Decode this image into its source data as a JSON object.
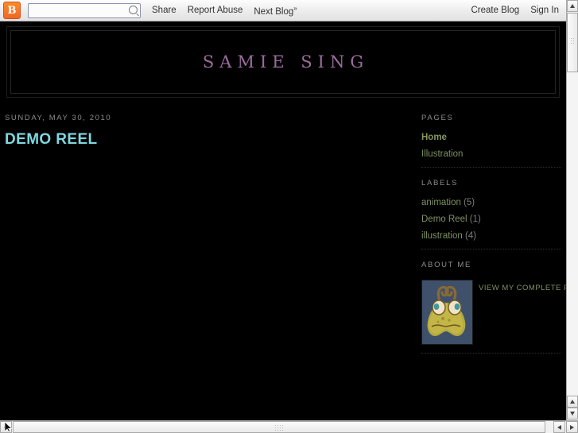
{
  "navbar": {
    "logo_icon": "blogger-b-icon",
    "logo_letter": "B",
    "search_placeholder": "",
    "search_value": "",
    "search_icon": "search-icon",
    "links": [
      {
        "label": "Share"
      },
      {
        "label": "Report Abuse"
      },
      {
        "label": "Next Blog",
        "chevron": "»"
      }
    ],
    "right_links": [
      {
        "label": "Create Blog"
      },
      {
        "label": "Sign In"
      }
    ]
  },
  "header": {
    "blog_title": "SAMIE SING",
    "title_color": "#9d6b9e"
  },
  "post": {
    "date": "SUNDAY, MAY 30, 2010",
    "title": "DEMO REEL",
    "title_color": "#7fd8e0"
  },
  "sidebar": {
    "pages": {
      "title": "PAGES",
      "items": [
        {
          "label": "Home",
          "current": true
        },
        {
          "label": "Illustration",
          "current": false
        }
      ]
    },
    "labels": {
      "title": "LABELS",
      "items": [
        {
          "label": "animation",
          "count": "(5)"
        },
        {
          "label": "Demo Reel",
          "count": "(1)"
        },
        {
          "label": "illustration",
          "count": "(4)"
        }
      ]
    },
    "about": {
      "title": "ABOUT ME",
      "photo_alt": "profile-avatar-creature",
      "profile_link": "VIEW MY COMPLETE PRO"
    },
    "link_color": "#7e9161"
  },
  "scrollbars": {
    "vertical": {
      "up_icon": "scroll-up-arrow-icon",
      "down_icon": "scroll-down-arrow-icon"
    },
    "horizontal": {
      "left_icon": "scroll-left-arrow-icon",
      "right_icon": "scroll-right-arrow-icon"
    }
  }
}
